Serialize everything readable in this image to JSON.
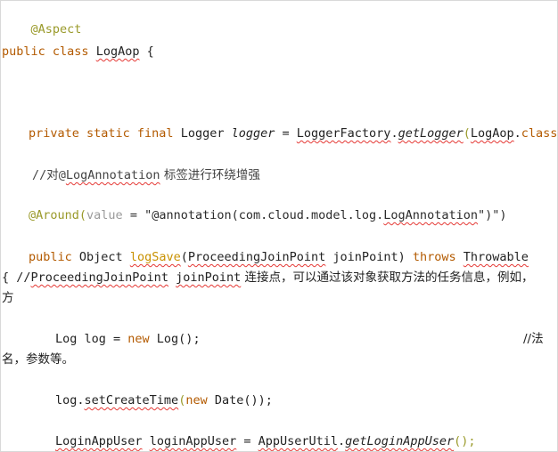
{
  "code": {
    "l1": "@Aspect",
    "l2_kw1": "public",
    "l2_kw2": "class",
    "l2_name": "LogAop",
    "l2_brace": " {",
    "l3_indent": "    ",
    "l3_kw": "private static final",
    "l3_type": " Logger ",
    "l3_var": "logger",
    "l3_eq": " = ",
    "l3_factory": "LoggerFactory",
    "l3_dot": ".",
    "l3_method": "getLogger",
    "l3_paren": "(",
    "l3_arg": "LogAop",
    "l3_dot2": ".",
    "l3_class": "class",
    "l3_end": ");",
    "l4_prefix": "//对@",
    "l4_anno": "LogAnnotation",
    "l4_text": " 标签进行环绕增强",
    "l5_anno": "@Around",
    "l5_paren": "(",
    "l5_value": "value",
    "l5_eq": " = \"@annotation(com.cloud.model.log.",
    "l5_annoname": "LogAnnotation",
    "l5_end": "\")\")",
    "l6_kw": "public",
    "l6_obj": " Object ",
    "l6_fn": "logSave",
    "l6_p1": "(",
    "l6_pjp": "ProceedingJoinPoint",
    "l6_jp": " joinPoint",
    "l6_p2": ") ",
    "l6_throws": "throws",
    "l6_sp": " ",
    "l6_throwable": "Throwable",
    "l7_start": "{ //",
    "l7_pjp": "ProceedingJoinPoint",
    "l7_sp": " ",
    "l7_jp": "joinPoint",
    "l7_text": " 连接点，可以通过该对象获取方法的任务信息，例如，",
    "l8": "方",
    "l9_type": "Log log = ",
    "l9_new": "new",
    "l9_log": " Log();",
    "l9_comment": "//法",
    "l10": "名，参数等。",
    "l11_obj": "log.",
    "l11_method": "setCreateTime",
    "l11_p": "(",
    "l11_new": "new",
    "l11_date": " Date());",
    "l12_type": "LoginAppUser",
    "l12_sp": " ",
    "l12_var": "loginAppUser",
    "l12_eq": " = ",
    "l12_util": "AppUserUtil",
    "l12_dot": ".",
    "l12_method": "getLoginAppUser",
    "l12_end": "();"
  },
  "colors": {
    "keyword": "#b35a00",
    "annotation": "#9a9a2a",
    "method_highlight": "#c99100",
    "squiggle": "#e53935"
  }
}
